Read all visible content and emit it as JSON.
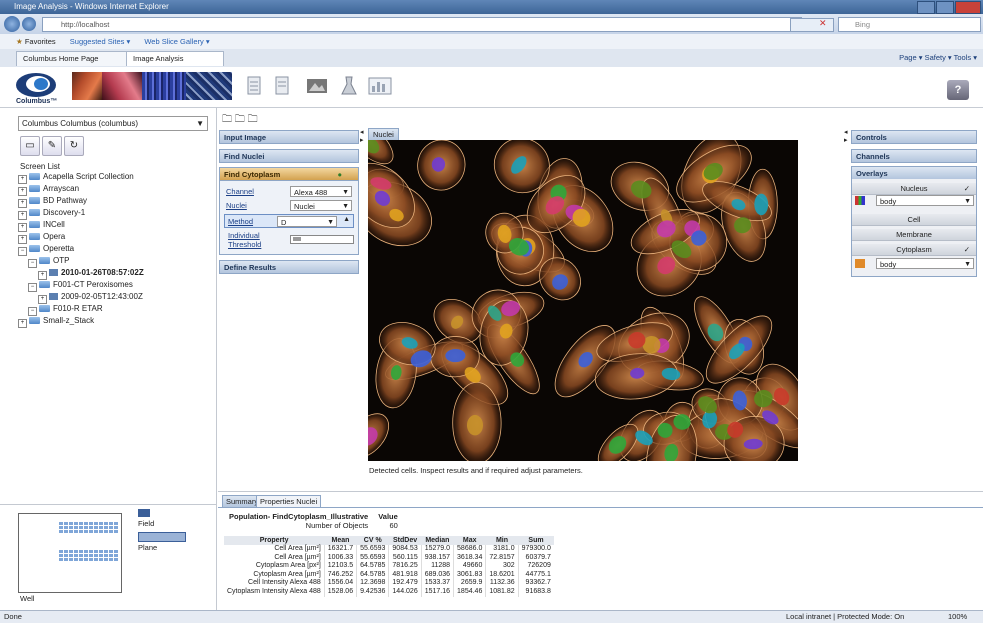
{
  "browser": {
    "window_title": "Image Analysis - Windows Internet Explorer",
    "url": "http://localhost",
    "search_placeholder": "Bing",
    "favorites_label": "Favorites",
    "fav_suggested": "Suggested Sites ▾",
    "fav_webslice": "Web Slice Gallery ▾",
    "tabs": [
      {
        "label": "Columbus Home Page"
      },
      {
        "label": "Image Analysis"
      }
    ],
    "commands": "Page ▾  Safety ▾  Tools ▾",
    "status_left": "Done",
    "status_zone": "Local intranet | Protected Mode: On",
    "zoom": "100%"
  },
  "app": {
    "logo_text": "Columbus™",
    "server": "Columbus Columbus (columbus)",
    "screen_list_label": "Screen List",
    "tree": [
      {
        "label": "Acapella Script Collection",
        "level": 0,
        "bold": false
      },
      {
        "label": "Arrayscan",
        "level": 0,
        "bold": false
      },
      {
        "label": "BD Pathway",
        "level": 0,
        "bold": false
      },
      {
        "label": "Discovery-1",
        "level": 0,
        "bold": false
      },
      {
        "label": "INCell",
        "level": 0,
        "bold": false
      },
      {
        "label": "Opera",
        "level": 0,
        "bold": false
      },
      {
        "label": "Operetta",
        "level": 0,
        "bold": false
      },
      {
        "label": "OTP",
        "level": 1,
        "bold": false
      },
      {
        "label": "2010-01-26T08:57:02Z",
        "level": 2,
        "bold": true
      },
      {
        "label": "F001-CT Peroxisomes",
        "level": 1,
        "bold": false
      },
      {
        "label": "2009-02-05T12:43:00Z",
        "level": 2,
        "bold": false
      },
      {
        "label": "F010-R ETAR",
        "level": 1,
        "bold": false
      },
      {
        "label": "Small-z_Stack",
        "level": 0,
        "bold": false
      }
    ],
    "well": {
      "field_label": "Field",
      "plane_label": "Plane",
      "well_label": "Well"
    }
  },
  "analysis": {
    "steps": {
      "input_image": "Input Image",
      "find_nuclei": "Find Nuclei",
      "find_cytoplasm": "Find Cytoplasm",
      "define_results": "Define Results"
    },
    "find_cytoplasm": {
      "channel_label": "Channel",
      "channel_value": "Alexa 488",
      "nuclei_label": "Nuclei",
      "nuclei_value": "Nuclei",
      "method_label": "Method",
      "method_value": "D",
      "threshold_label_1": "Individual",
      "threshold_label_2": "Threshold"
    }
  },
  "image": {
    "tab_label": "Nuclei",
    "caption": "Detected cells. Inspect results and if required adjust parameters."
  },
  "right": {
    "controls": "Controls",
    "channels": "Channels",
    "overlays": "Overlays",
    "nucleus": "Nucleus",
    "nucleus_select": "body",
    "cell": "Cell",
    "membrane": "Membrane",
    "cytoplasm": "Cytoplasm",
    "cytoplasm_select": "body"
  },
  "results": {
    "tabs": [
      {
        "label": "Summary"
      },
      {
        "label": "Properties Nuclei"
      }
    ],
    "population_header": "Population- FindCytoplasm_Illustrative",
    "value_header": "Value",
    "objects_label": "Number of Objects",
    "objects_value": "60",
    "columns": [
      "Property",
      "Mean",
      "CV %",
      "StdDev",
      "Median",
      "Max",
      "Min",
      "Sum"
    ],
    "rows": [
      [
        "Cell Area [µm²]",
        "16321.7",
        "55.6593",
        "9084.53",
        "15279.0",
        "58686.0",
        "3181.0",
        "979300.0"
      ],
      [
        "Cell Area [µm²]",
        "1006.33",
        "55.6593",
        "560.115",
        "938.157",
        "3618.34",
        "72.8157",
        "60379.7"
      ],
      [
        "Cytoplasm Area [px²]",
        "12103.5",
        "64.5785",
        "7816.25",
        "11288",
        "49660",
        "302",
        "726209"
      ],
      [
        "Cytoplasm Area [µm²]",
        "746.252",
        "64.5785",
        "481.918",
        "689.036",
        "3061.83",
        "18.6201",
        "44775.1"
      ],
      [
        "Cell Intensity Alexa 488",
        "1556.04",
        "12.3698",
        "192.479",
        "1533.37",
        "2659.9",
        "1132.36",
        "93362.7"
      ],
      [
        "Cytoplasm Intensity Alexa 488",
        "1528.06",
        "9.42536",
        "144.026",
        "1517.16",
        "1854.46",
        "1081.82",
        "91683.8"
      ]
    ]
  }
}
